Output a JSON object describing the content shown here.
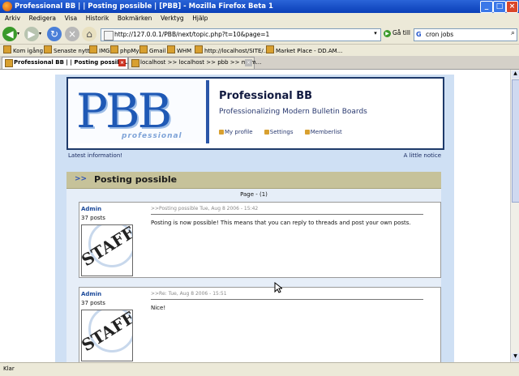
{
  "window": {
    "title": "Professional BB | | Posting possible | [PBB] - Mozilla Firefox Beta 1"
  },
  "menu": [
    "Arkiv",
    "Redigera",
    "Visa",
    "Historik",
    "Bokmärken",
    "Verktyg",
    "Hjälp"
  ],
  "navigation": {
    "url": "http://127.0.0.1/PBB/next/topic.php?t=10&page=1",
    "go_label": "Gå till",
    "search_value": "cron jobs"
  },
  "bookmarks": [
    "Kom igång",
    "Senaste nytt",
    "IMG",
    "phpMy",
    "Gmail",
    "WHM",
    "http://localhost/SITE/...",
    "Market Place - DD.AM..."
  ],
  "tabs": [
    {
      "label": "Professional BB | | Posting possibl..."
    },
    {
      "label": "localhost >> localhost >> pbb >> mem..."
    }
  ],
  "forum": {
    "logo_text": "PBB",
    "logo_sub": "professional",
    "site_title": "Professional BB",
    "site_desc": "Professionalizing Modern Bulletin Boards",
    "nav": [
      "My profile",
      "Settings",
      "Memberlist"
    ],
    "latest": "Latest information!",
    "notice": "A little notice",
    "topic_arrow": ">>",
    "topic_title": "Posting possible",
    "page_indicator": "Page - (1)",
    "posts": [
      {
        "author": "Admin",
        "post_count": "37 posts",
        "avatar_text": "STAFF",
        "meta": ">>Posting possible    Tue, Aug 8 2006 - 15:42",
        "body": "Posting is now possible! This means that you can reply to threads and post your own posts."
      },
      {
        "author": "Admin",
        "post_count": "37 posts",
        "avatar_text": "STAFF",
        "meta": ">>Re:    Tue, Aug 8 2006 - 15:51",
        "body": "Nice!"
      }
    ]
  },
  "status": {
    "text": "Klar"
  }
}
